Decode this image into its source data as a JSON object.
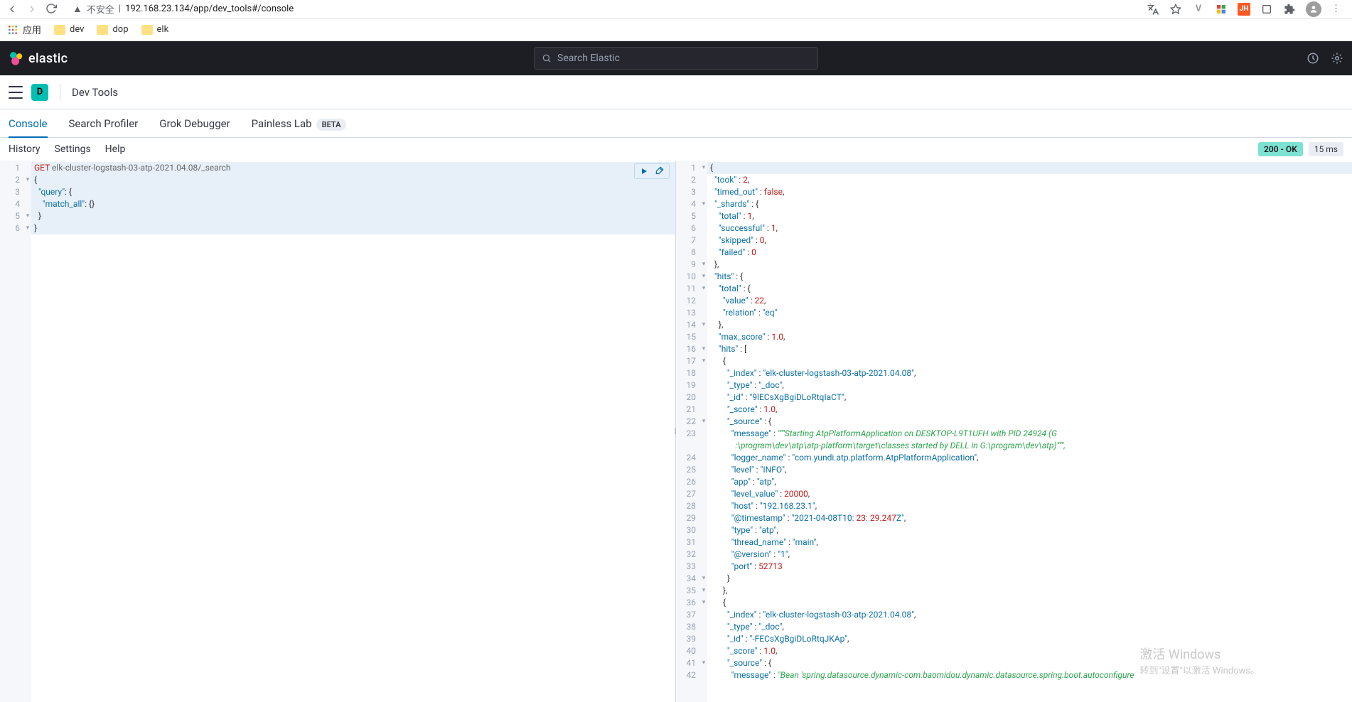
{
  "browser": {
    "insecure_label": "不安全",
    "url": "192.168.23.134/app/dev_tools#/console"
  },
  "bookmarks": {
    "apps": "应用",
    "items": [
      "dev",
      "dop",
      "elk"
    ]
  },
  "elastic": {
    "brand": "elastic",
    "search_placeholder": "Search Elastic"
  },
  "crumb": {
    "space_letter": "D",
    "label": "Dev Tools"
  },
  "tabs": {
    "console": "Console",
    "profiler": "Search Profiler",
    "grok": "Grok Debugger",
    "painless": "Painless Lab",
    "beta": "BETA"
  },
  "toolbar": {
    "history": "History",
    "settings": "Settings",
    "help": "Help",
    "status": "200 - OK",
    "timing": "15 ms"
  },
  "editor": {
    "method": "GET",
    "path": "elk-cluster-logstash-03-atp-2021.04.08/_search",
    "body_lines": [
      "{",
      "  \"query\": {",
      "    \"match_all\": {}",
      "  }",
      "}"
    ]
  },
  "response_lines": [
    {
      "n": 1,
      "f": "-",
      "t": "{"
    },
    {
      "n": 2,
      "f": "",
      "t": "  \"took\" : 2,"
    },
    {
      "n": 3,
      "f": "",
      "t": "  \"timed_out\" : false,"
    },
    {
      "n": 4,
      "f": "-",
      "t": "  \"_shards\" : {"
    },
    {
      "n": 5,
      "f": "",
      "t": "    \"total\" : 1,"
    },
    {
      "n": 6,
      "f": "",
      "t": "    \"successful\" : 1,"
    },
    {
      "n": 7,
      "f": "",
      "t": "    \"skipped\" : 0,"
    },
    {
      "n": 8,
      "f": "",
      "t": "    \"failed\" : 0"
    },
    {
      "n": 9,
      "f": "-",
      "t": "  },"
    },
    {
      "n": 10,
      "f": "-",
      "t": "  \"hits\" : {"
    },
    {
      "n": 11,
      "f": "-",
      "t": "    \"total\" : {"
    },
    {
      "n": 12,
      "f": "",
      "t": "      \"value\" : 22,"
    },
    {
      "n": 13,
      "f": "",
      "t": "      \"relation\" : \"eq\""
    },
    {
      "n": 14,
      "f": "-",
      "t": "    },"
    },
    {
      "n": 15,
      "f": "",
      "t": "    \"max_score\" : 1.0,"
    },
    {
      "n": 16,
      "f": "-",
      "t": "    \"hits\" : ["
    },
    {
      "n": 17,
      "f": "-",
      "t": "      {"
    },
    {
      "n": 18,
      "f": "",
      "t": "        \"_index\" : \"elk-cluster-logstash-03-atp-2021.04.08\","
    },
    {
      "n": 19,
      "f": "",
      "t": "        \"_type\" : \"_doc\","
    },
    {
      "n": 20,
      "f": "",
      "t": "        \"_id\" : \"9lECsXgBgiDLoRtqIaCT\","
    },
    {
      "n": 21,
      "f": "",
      "t": "        \"_score\" : 1.0,"
    },
    {
      "n": 22,
      "f": "-",
      "t": "        \"_source\" : {"
    },
    {
      "n": 23,
      "f": "",
      "t": "          \"message\" : \"\"\"Starting AtpPlatformApplication on DESKTOP-L9T1UFH with PID 24924 (G",
      "green": true
    },
    {
      "n": "",
      "f": "",
      "t": "            :\\program\\dev\\atp\\atp-platform\\target\\classes started by DELL in G:\\program\\dev\\atp)\"\"\",",
      "green": true
    },
    {
      "n": 24,
      "f": "",
      "t": "          \"logger_name\" : \"com.yundi.atp.platform.AtpPlatformApplication\","
    },
    {
      "n": 25,
      "f": "",
      "t": "          \"level\" : \"INFO\","
    },
    {
      "n": 26,
      "f": "",
      "t": "          \"app\" : \"atp\","
    },
    {
      "n": 27,
      "f": "",
      "t": "          \"level_value\" : 20000,"
    },
    {
      "n": 28,
      "f": "",
      "t": "          \"host\" : \"192.168.23.1\","
    },
    {
      "n": 29,
      "f": "",
      "t": "          \"@timestamp\" : \"2021-04-08T10:23:29.247Z\","
    },
    {
      "n": 30,
      "f": "",
      "t": "          \"type\" : \"atp\","
    },
    {
      "n": 31,
      "f": "",
      "t": "          \"thread_name\" : \"main\","
    },
    {
      "n": 32,
      "f": "",
      "t": "          \"@version\" : \"1\","
    },
    {
      "n": 33,
      "f": "",
      "t": "          \"port\" : 52713"
    },
    {
      "n": 34,
      "f": "-",
      "t": "        }"
    },
    {
      "n": 35,
      "f": "-",
      "t": "      },"
    },
    {
      "n": 36,
      "f": "-",
      "t": "      {"
    },
    {
      "n": 37,
      "f": "",
      "t": "        \"_index\" : \"elk-cluster-logstash-03-atp-2021.04.08\","
    },
    {
      "n": 38,
      "f": "",
      "t": "        \"_type\" : \"_doc\","
    },
    {
      "n": 39,
      "f": "",
      "t": "        \"_id\" : \"-FECsXgBgiDLoRtqJKAp\","
    },
    {
      "n": 40,
      "f": "",
      "t": "        \"_score\" : 1.0,"
    },
    {
      "n": 41,
      "f": "-",
      "t": "        \"_source\" : {"
    },
    {
      "n": 42,
      "f": "",
      "t": "          \"message\" : \"Bean 'spring.datasource.dynamic-com.baomidou.dynamic.datasource.spring.boot.autoconfigure",
      "green": true
    }
  ],
  "watermark": {
    "title": "激活 Windows",
    "sub": "转到\"设置\"以激活 Windows。"
  }
}
